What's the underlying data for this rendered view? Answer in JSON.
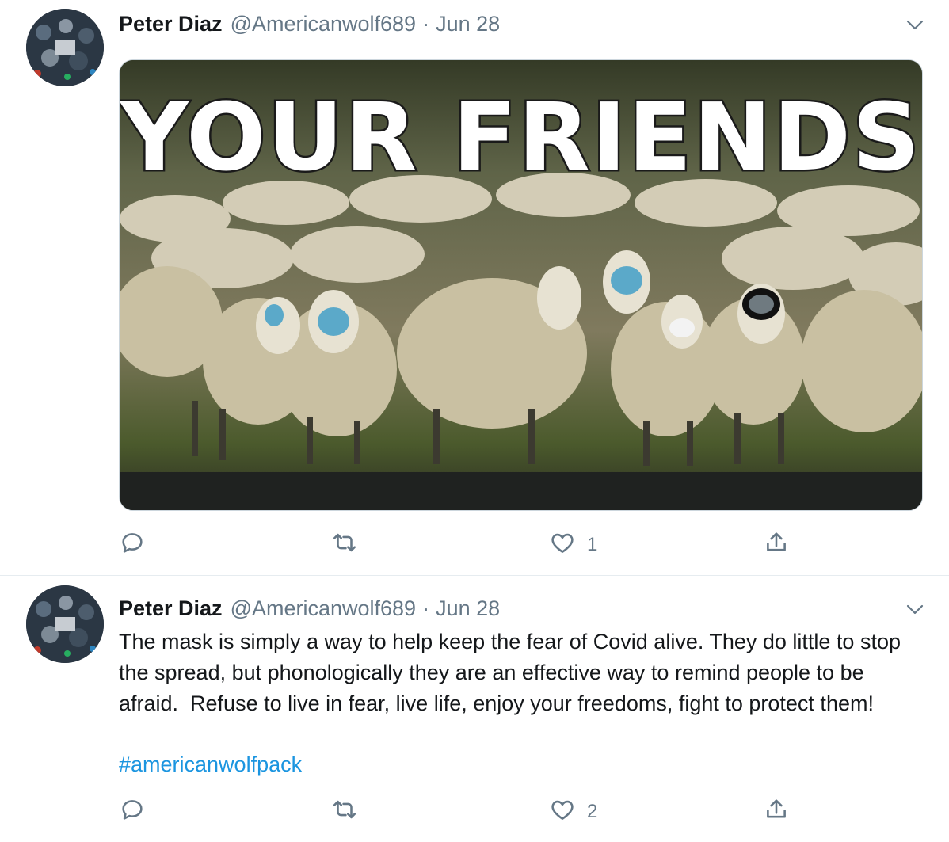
{
  "tweets": [
    {
      "name": "Peter Diaz",
      "handle": "@Americanwolf689",
      "separator": "·",
      "date": "Jun 28",
      "media_caption": "YOUR FRIENDS",
      "reply_count": "",
      "retweet_count": "",
      "like_count": "1"
    },
    {
      "name": "Peter Diaz",
      "handle": "@Americanwolf689",
      "separator": "·",
      "date": "Jun 28",
      "text": "The mask is simply a way to help keep the fear of Covid alive. They do little to stop the spread, but phonologically they are an effective way to remind people to be afraid.  Refuse to live in fear, live life, enjoy your freedoms, fight to protect them!",
      "hashtag": "#americanwolfpack",
      "reply_count": "",
      "retweet_count": "",
      "like_count": "2"
    }
  ],
  "colors": {
    "text": "#14171a",
    "secondary": "#657786",
    "link": "#1b95e0",
    "divider": "#e6ecf0"
  },
  "icons": [
    "chevron-down-icon",
    "reply-icon",
    "retweet-icon",
    "like-icon",
    "share-icon"
  ]
}
